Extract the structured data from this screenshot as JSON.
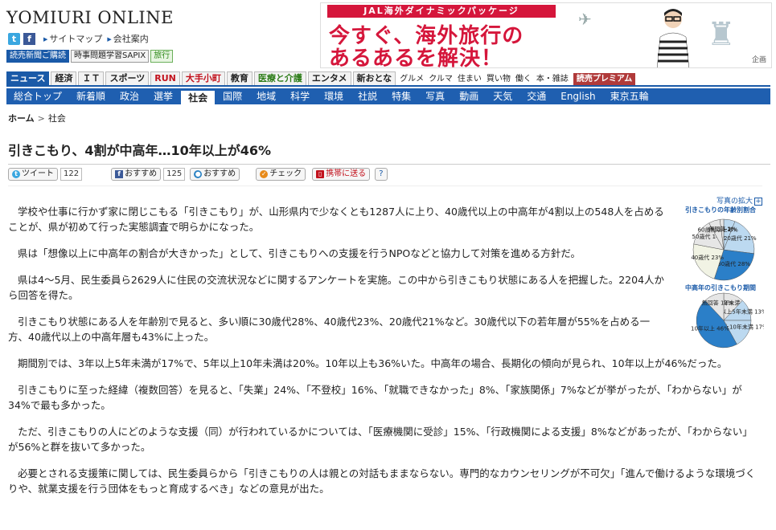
{
  "header": {
    "logo": "YOMIURI ONLINE",
    "twitter_glyph": "t",
    "facebook_glyph": "f",
    "links": [
      "サイトマップ",
      "会社案内"
    ],
    "badges": [
      "読売新聞ご購読",
      "時事問題学習SAPIX",
      "旅行"
    ]
  },
  "ad": {
    "headline": "JAL海外ダイナミックパッケージ",
    "line1": "今すぐ、海外旅行の",
    "line2": "あるあるを解決！",
    "corner": "企画"
  },
  "nav_main": {
    "tabs": [
      "ニュース",
      "経済",
      "ＩＴ",
      "スポーツ",
      "RUN",
      "大手小町",
      "教育",
      "医療と介護",
      "エンタメ",
      "新おとな"
    ],
    "plain": [
      "グルメ",
      "クルマ",
      "住まい",
      "買い物",
      "働く",
      "本・雑誌"
    ],
    "premium": "読売プレミアム"
  },
  "nav_sub": [
    "総合トップ",
    "新着順",
    "政治",
    "選挙",
    "社会",
    "国際",
    "地域",
    "科学",
    "環境",
    "社説",
    "特集",
    "写真",
    "動画",
    "天気",
    "交通",
    "English",
    "東京五輪"
  ],
  "breadcrumb": {
    "home": "ホーム",
    "sep": ">",
    "current": "社会"
  },
  "article": {
    "title": "引きこもり、4割が中高年…10年以上が46%",
    "share": {
      "tweet": "ツイート",
      "tweet_count": "122",
      "fb": "おすすめ",
      "fb_count": "125",
      "mixi": "おすすめ",
      "check": "チェック",
      "mobile": "携帯に送る",
      "help": "?"
    },
    "paragraphs": [
      "学校や仕事に行かず家に閉じこもる「引きこもり」が、山形県内で少なくとも1287人に上り、40歳代以上の中高年が4割以上の548人を占めることが、県が初めて行った実態調査で明らかになった。",
      "県は「想像以上に中高年の割合が大きかった」として、引きこもりへの支援を行うNPOなどと協力して対策を進める方針だ。",
      "県は4～5月、民生委員ら2629人に住民の交流状況などに関するアンケートを実施。この中から引きこもり状態にある人を把握した。2204人から回答を得た。",
      "引きこもり状態にある人を年齢別で見ると、多い順に30歳代28%、40歳代23%、20歳代21%など。30歳代以下の若年層が55%を占める一方、40歳代以上の中高年層も43%に上った。",
      "期間別では、3年以上5年未満が17%で、5年以上10年未満は20%。10年以上も36%いた。中高年の場合、長期化の傾向が見られ、10年以上が46%だった。",
      "引きこもりに至った経緯（複数回答）を見ると、「失業」24%、「不登校」16%、「就職できなかった」8%、「家族関係」7%などが挙がったが、「わからない」が34%で最も多かった。",
      "ただ、引きこもりの人にどのような支援（同）が行われているかについては、「医療機関に受診」15%、「行政機関による支援」8%などがあったが、「わからない」が56%と群を抜いて多かった。",
      "必要とされる支援策に関しては、民生委員らから「引きこもりの人は親との対話もままならない。専門的なカウンセリングが不可欠」「進んで働けるような環境づくりや、就業支援を行う団体をもっと育成するべき」などの意見が出た。"
    ]
  },
  "figure": {
    "zoom_label": "写真の拡大",
    "zoom_plus": "+",
    "chart1_title": "引きこもりの年齢別割合",
    "chart2_title": "中高年の引きこもり期間",
    "colors": {
      "blue": "#2b7fc8",
      "light": "#bcd9f0",
      "gray": "#e6e6e6",
      "pale": "#f1f3e4"
    }
  },
  "chart_data": [
    {
      "type": "pie",
      "title": "引きこもりの年齢別割合",
      "labels": [
        "15〜19歳",
        "20歳代",
        "30歳代",
        "40歳代",
        "50歳代",
        "60歳代以上",
        "無回答"
      ],
      "label_texts": [
        "15〜19歳",
        "20歳代 21%",
        "30歳代 28%",
        "40歳代 23%",
        "50歳代 14%",
        "60歳代以上 6%",
        "無回答 2%"
      ],
      "values": [
        6,
        21,
        28,
        23,
        14,
        6,
        2
      ]
    },
    {
      "type": "pie",
      "title": "中高年の引きこもり期間",
      "labels": [
        "1年未満",
        "3年以上5年未満",
        "5年以上10年未満",
        "10年以上",
        "無回答"
      ],
      "label_texts": [
        "1年未満",
        "3年以上5年未満 13%",
        "5年以上10年未満 17%",
        "10年以上 46%",
        "無回答 12%"
      ],
      "values": [
        12,
        13,
        17,
        46,
        12
      ]
    }
  ]
}
